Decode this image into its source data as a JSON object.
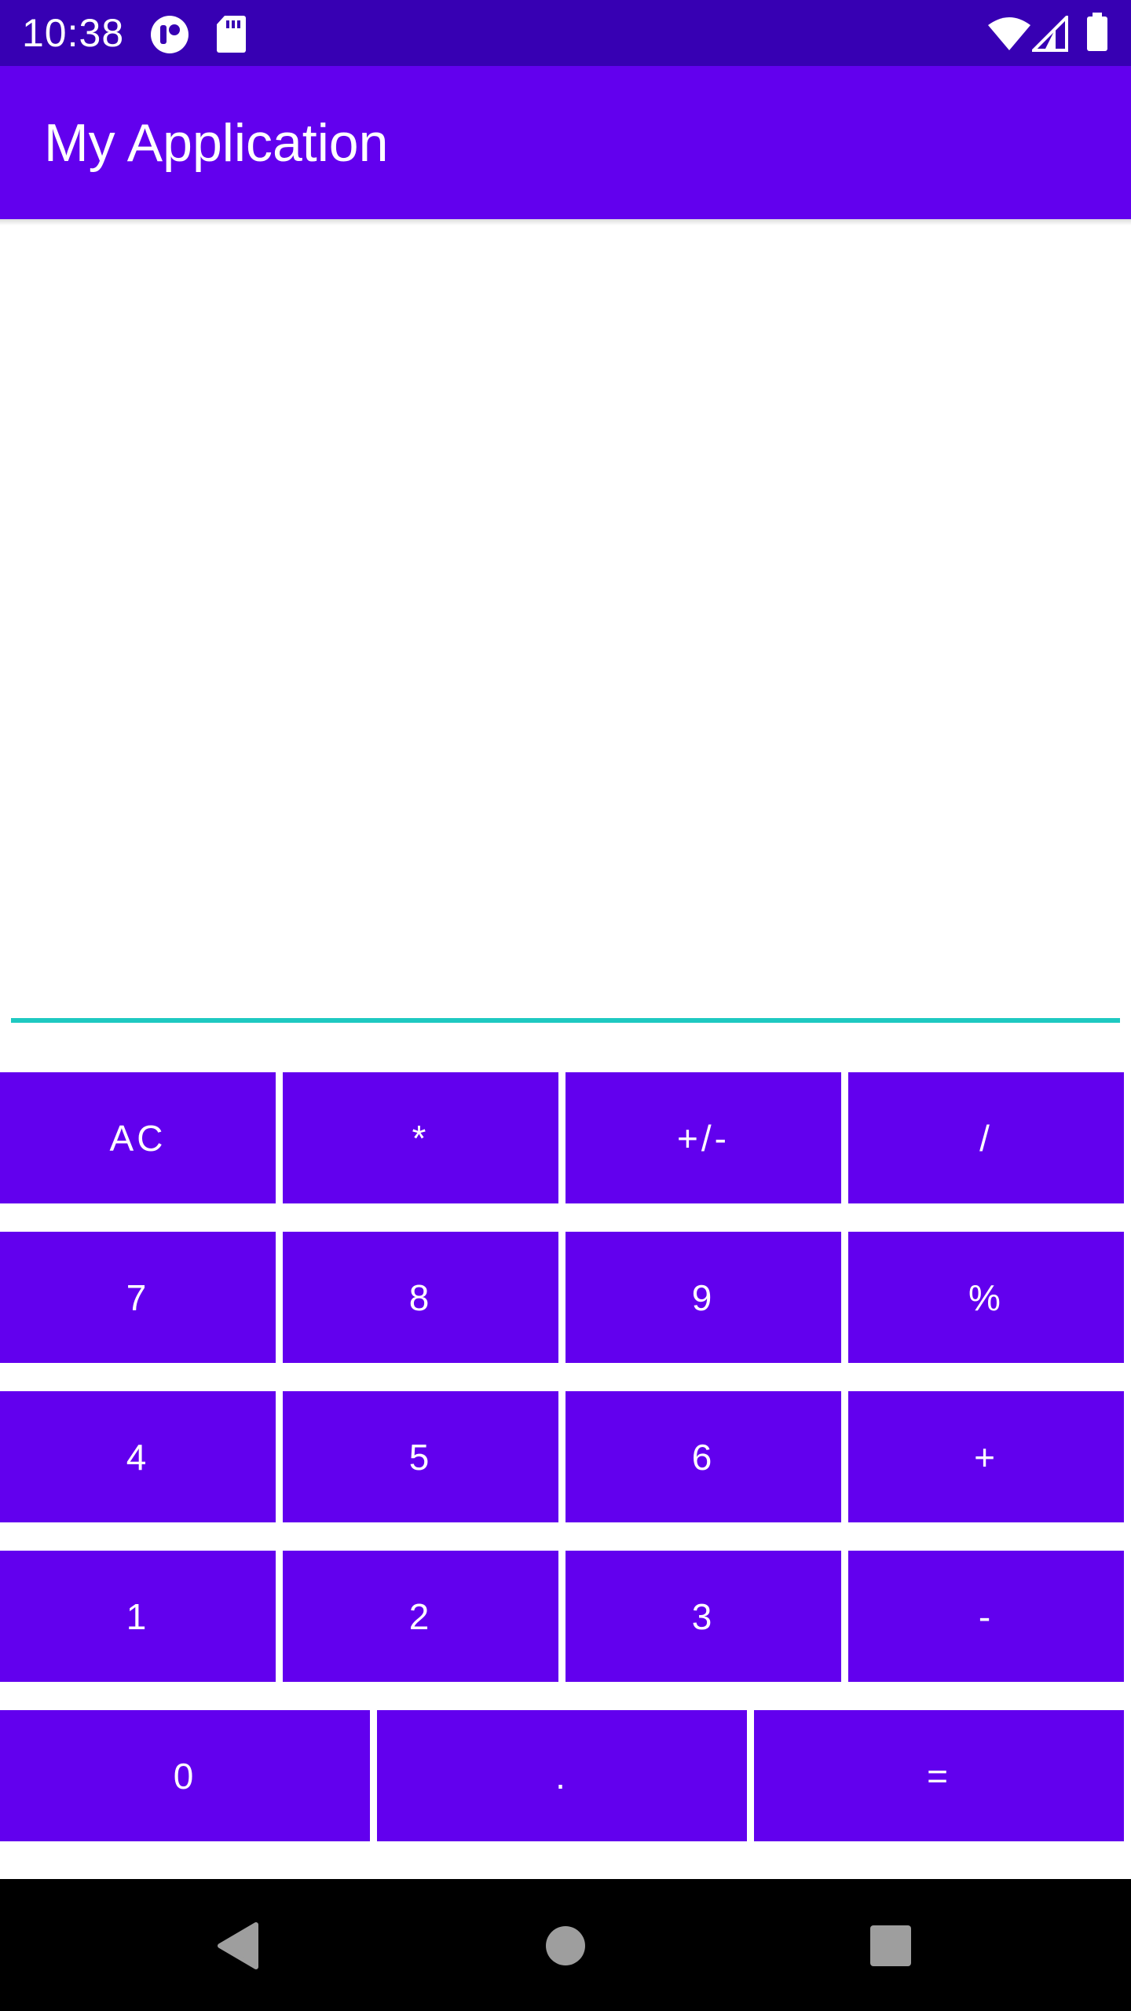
{
  "status_bar": {
    "time": "10:38",
    "icons": [
      "app-notification-icon",
      "sd-card-icon",
      "wifi-icon",
      "cell-signal-icon",
      "battery-icon"
    ]
  },
  "app_bar": {
    "title": "My Application",
    "color": "#6200ee"
  },
  "display": {
    "value": "",
    "underline_color": "#1ec9c1"
  },
  "keypad": {
    "button_color": "#6200ee",
    "rows": [
      [
        "AC",
        "*",
        "+/-",
        "/"
      ],
      [
        "7",
        "8",
        "9",
        "%"
      ],
      [
        "4",
        "5",
        "6",
        "+"
      ],
      [
        "1",
        "2",
        "3",
        "-"
      ],
      [
        "0",
        ".",
        "="
      ]
    ]
  },
  "nav_bar": {
    "icons": [
      "back-icon",
      "home-icon",
      "recents-icon"
    ]
  }
}
